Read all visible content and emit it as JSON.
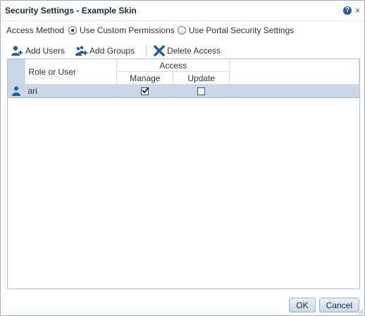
{
  "dialog": {
    "title": "Security Settings - Example Skin",
    "help_icon_glyph": "?",
    "close_icon_glyph": "×"
  },
  "access_method": {
    "label": "Access Method",
    "options": [
      {
        "label": "Use Custom Permissions",
        "checked": true
      },
      {
        "label": "Use Portal Security Settings",
        "checked": false
      }
    ]
  },
  "toolbar": {
    "add_users": {
      "label": "Add Users",
      "icon": "add-user-icon"
    },
    "add_groups": {
      "label": "Add Groups",
      "icon": "add-group-icon"
    },
    "delete_access": {
      "label": "Delete Access",
      "icon": "delete-x-icon"
    }
  },
  "grid": {
    "headers": {
      "role": "Role or User",
      "access": "Access",
      "manage": "Manage",
      "update": "Update"
    },
    "rows": [
      {
        "icon": "user-icon",
        "name": "ari",
        "manage": true,
        "update": false,
        "selected": true
      }
    ]
  },
  "footer": {
    "ok_label": "OK",
    "cancel_label": "Cancel"
  },
  "colors": {
    "selection": "#c9d7e6",
    "accent_icon": "#1f5f9f",
    "delete_icon": "#1f5f9f"
  }
}
